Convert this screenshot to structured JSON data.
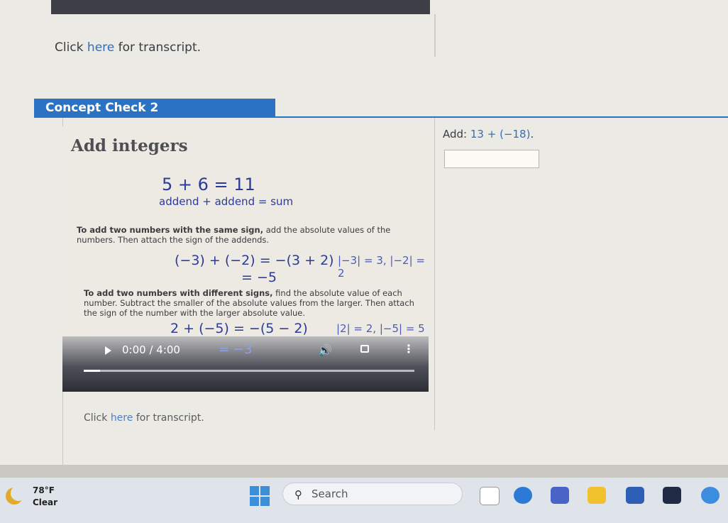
{
  "page": {
    "top_transcript": {
      "before": "Click ",
      "link": "here",
      "after": " for transcript."
    },
    "concept_check_title": "Concept Check 2",
    "video": {
      "title": "Add integers",
      "eq1": "5 + 6 = 11",
      "eq1_labels": "addend + addend = sum",
      "para1_bold": "To add two numbers with the same sign,",
      "para1_rest": " add the absolute values of the numbers. Then attach the sign of the addends.",
      "eq2": "(−3) + (−2) = −(3 + 2)",
      "eq2b": "= −5",
      "abs1": "|−3| = 3, |−2| = 2",
      "para2_bold": "To add two numbers with different signs,",
      "para2_rest": " find the absolute value of each number. Subtract the smaller of the absolute values from the larger. Then attach the sign of the number with the larger absolute value.",
      "eq3": "2 + (−5) = −(5 − 2)",
      "abs2": "|2| = 2, |−5| = 5",
      "eq_last": "= −3",
      "time": "0:00 / 4:00",
      "progress": 0.05
    },
    "bottom_transcript": {
      "before": "Click ",
      "link": "here",
      "after": " for transcript."
    },
    "question": {
      "prefix": "Add: ",
      "math": "13 + (−18)",
      "suffix": "."
    },
    "answer_value": ""
  },
  "taskbar": {
    "temperature": "78°F",
    "condition": "Clear",
    "search_placeholder": "Search",
    "colors": {
      "start": "#3b8fd9",
      "moon": "#e3a92b"
    }
  }
}
